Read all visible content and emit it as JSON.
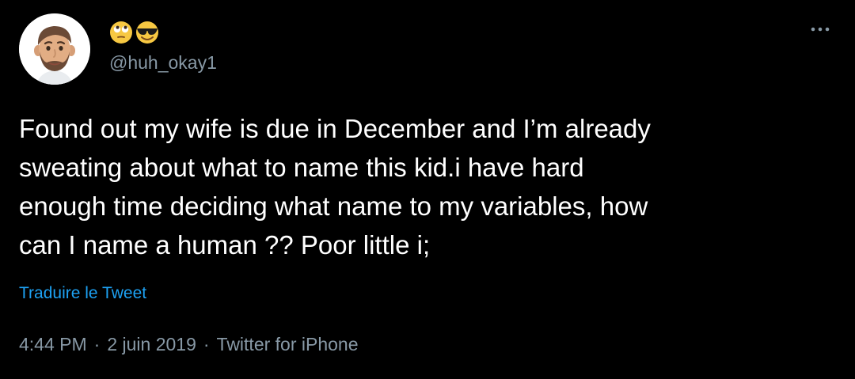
{
  "tweet": {
    "display_name_emojis": [
      "face-with-rolling-eyes-emoji",
      "smiling-face-with-sunglasses-emoji"
    ],
    "handle": "@huh_okay1",
    "text": "Found out my wife is due in December and I’m already\nsweating about what to name this kid.i have hard\nenough time deciding what name to my variables, how\ncan I name a human ?? Poor little i;",
    "translate_label": "Traduire le Tweet",
    "time": "4:44 PM",
    "date": "2 juin 2019",
    "source": "Twitter for iPhone",
    "separator": "·"
  },
  "icons": {
    "avatar": "memoji-avatar",
    "more": "more-options-icon"
  },
  "colors": {
    "background": "#000000",
    "text": "#ffffff",
    "secondary": "#8899a6",
    "link": "#1da1f2"
  }
}
